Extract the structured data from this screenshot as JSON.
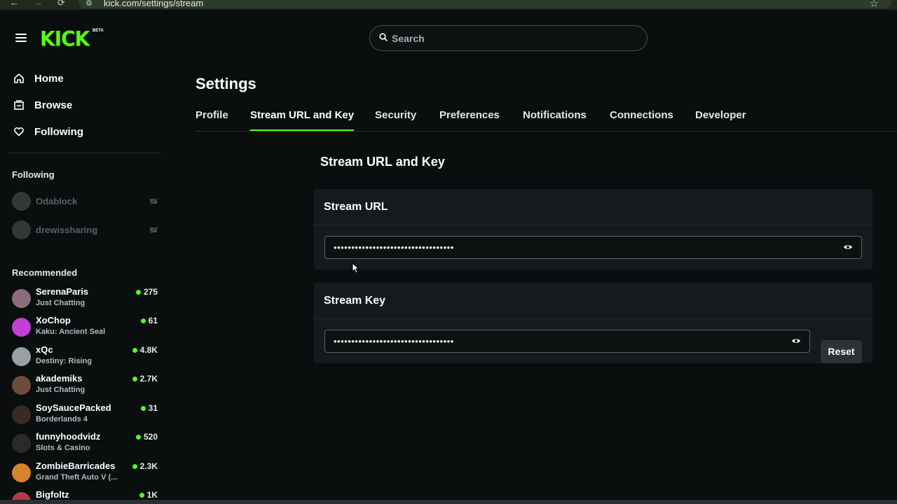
{
  "browser": {
    "url": "kick.com/settings/stream",
    "back_icon": "←",
    "forward_icon": "→",
    "reload_icon": "⟳",
    "star_icon": "☆"
  },
  "header": {
    "logo": "KICK",
    "logo_badge": "BETA",
    "search_placeholder": "Search",
    "accent_color": "#53fc18"
  },
  "sidebar": {
    "nav": [
      {
        "label": "Home",
        "icon": "home-icon"
      },
      {
        "label": "Browse",
        "icon": "browse-icon"
      },
      {
        "label": "Following",
        "icon": "heart-icon"
      }
    ],
    "following_heading": "Following",
    "following": [
      {
        "name": "Odablock"
      },
      {
        "name": "drewissharing"
      }
    ],
    "recommended_heading": "Recommended",
    "recommended": [
      {
        "name": "SerenaParis",
        "category": "Just Chatting",
        "viewers": "275"
      },
      {
        "name": "XoChop",
        "category": "Kaku: Ancient Seal",
        "viewers": "61"
      },
      {
        "name": "xQc",
        "category": "Destiny: Rising",
        "viewers": "4.8K"
      },
      {
        "name": "akademiks",
        "category": "Just Chatting",
        "viewers": "2.7K"
      },
      {
        "name": "SoySaucePacked",
        "category": "Borderlands 4",
        "viewers": "31"
      },
      {
        "name": "funnyhoodvidz",
        "category": "Slots & Casino",
        "viewers": "520"
      },
      {
        "name": "ZombieBarricades",
        "category": "Grand Theft Auto V (...",
        "viewers": "2.3K"
      },
      {
        "name": "Bigfoltz",
        "category": "",
        "viewers": "1K"
      }
    ]
  },
  "main": {
    "title": "Settings",
    "tabs": [
      "Profile",
      "Stream URL and Key",
      "Security",
      "Preferences",
      "Notifications",
      "Connections",
      "Developer"
    ],
    "active_tab": "Stream URL and Key",
    "section_title": "Stream URL and Key",
    "stream_url": {
      "label": "Stream URL",
      "value": "••••••••••••••••••••••••••••••••••"
    },
    "stream_key": {
      "label": "Stream Key",
      "value": "••••••••••••••••••••••••••••••••••",
      "reset_label": "Reset"
    }
  }
}
